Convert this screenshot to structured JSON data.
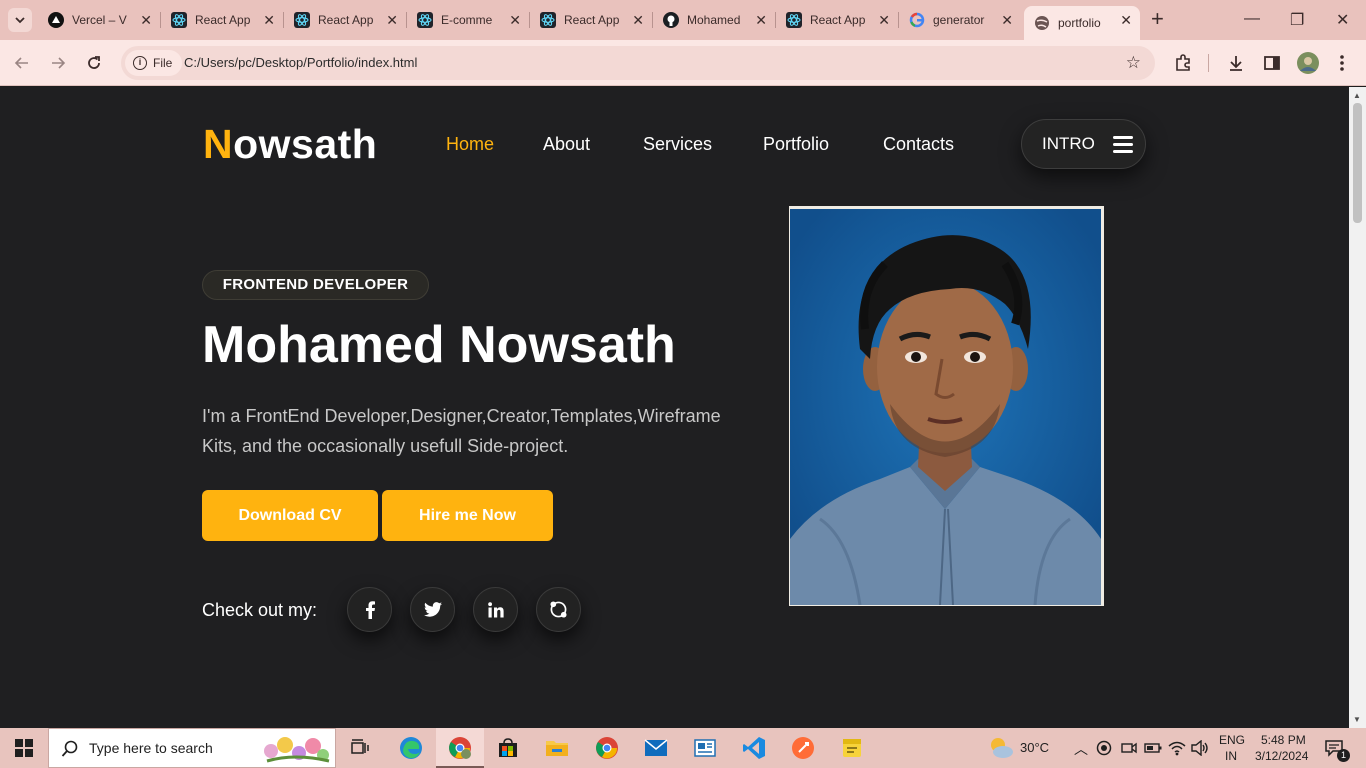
{
  "browser": {
    "tabs": [
      {
        "title": "Vercel – V",
        "icon": "vercel-icon"
      },
      {
        "title": "React App",
        "icon": "react-icon"
      },
      {
        "title": "React App",
        "icon": "react-icon"
      },
      {
        "title": "E-comme",
        "icon": "react-icon"
      },
      {
        "title": "React App",
        "icon": "react-icon"
      },
      {
        "title": "Mohamed",
        "icon": "github-icon"
      },
      {
        "title": "React App",
        "icon": "react-icon"
      },
      {
        "title": "generator",
        "icon": "google-icon"
      },
      {
        "title": "portfolio",
        "icon": "globe-icon"
      }
    ],
    "chip_label": "File",
    "url": "C:/Users/pc/Desktop/Portfolio/index.html"
  },
  "site": {
    "logo_first": "N",
    "logo_rest": "owsath",
    "nav": [
      "Home",
      "About",
      "Services",
      "Portfolio",
      "Contacts"
    ],
    "intro_label": "INTRO",
    "badge": "FRONTEND DEVELOPER",
    "name": "Mohamed Nowsath",
    "description": "I'm a FrontEnd Developer,Designer,Creator,Templates,Wireframe Kits, and the occasionally usefull Side-project.",
    "download_cv": "Download CV",
    "hire_me": "Hire me Now",
    "check_out": "Check out my:",
    "social": [
      "facebook-icon",
      "twitter-icon",
      "linkedin-icon",
      "skype-icon"
    ],
    "accent_color": "#ffb30f",
    "background_color": "#1f1f21"
  },
  "taskbar": {
    "search_placeholder": "Type here to search",
    "weather": "30°C",
    "lang_top": "ENG",
    "lang_bottom": "IN",
    "time": "5:48 PM",
    "date": "3/12/2024",
    "notification_count": "1"
  }
}
